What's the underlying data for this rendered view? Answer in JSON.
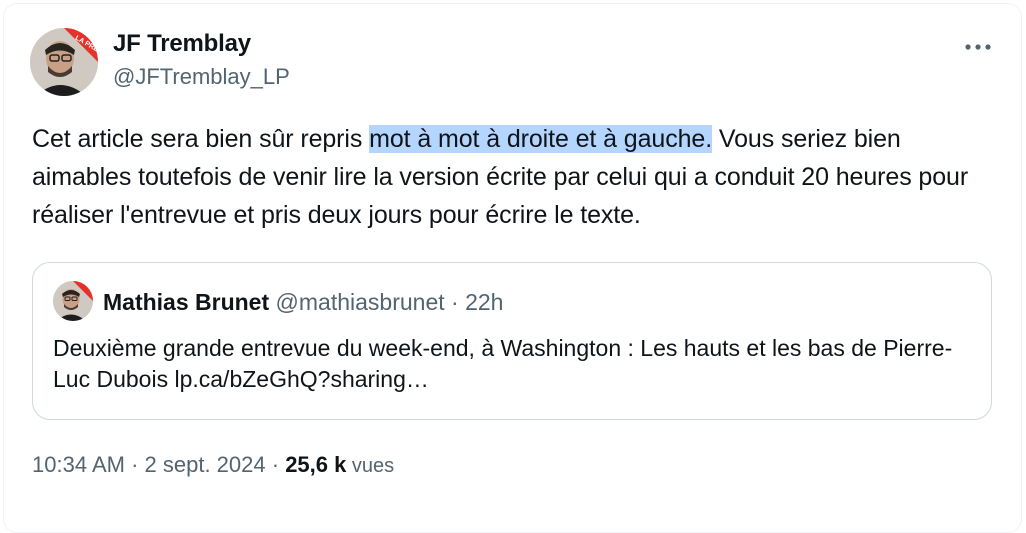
{
  "author": {
    "name": "JF Tremblay",
    "handle": "@JFTremblay_LP",
    "avatar_badge": "LA PRESSE"
  },
  "menu": {
    "icon": "more-horizontal-icon"
  },
  "tweet": {
    "text_before": "Cet article sera bien sûr repris ",
    "text_highlight": "mot à mot à droite et à gauche.",
    "text_after": " Vous seriez bien aimables toutefois de venir lire la version écrite par celui qui a conduit 20 heures pour réaliser l'entrevue et pris deux jours pour écrire le texte."
  },
  "quote": {
    "name": "Mathias Brunet",
    "handle": "@mathiasbrunet",
    "separator": " · ",
    "time": "22h",
    "text": "Deuxième grande entrevue du week-end, à Washington : Les hauts et les bas de Pierre-Luc Dubois ",
    "link": "lp.ca/bZeGhQ?sharing…"
  },
  "meta": {
    "time": "10:34 AM",
    "sep": " · ",
    "date": "2 sept. 2024",
    "views_count": "25,6 k",
    "views_label": " vues"
  },
  "colors": {
    "highlight": "#b4d5fe",
    "secondary_text": "#536471",
    "border": "#cfd9de",
    "brand_red": "#e4322b"
  }
}
